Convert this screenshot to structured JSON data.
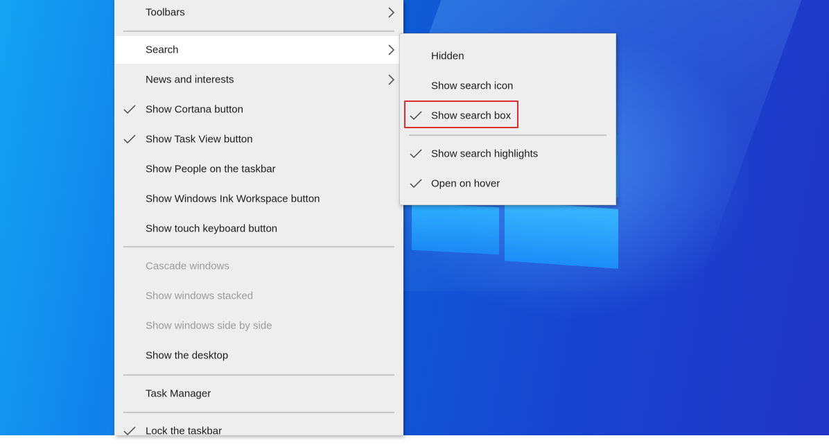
{
  "main_menu": {
    "items": [
      {
        "label": "Toolbars",
        "checked": false,
        "submenu": true,
        "disabled": false
      },
      {
        "label": "Search",
        "checked": false,
        "submenu": true,
        "disabled": false,
        "hover": true
      },
      {
        "label": "News and interests",
        "checked": false,
        "submenu": true,
        "disabled": false
      },
      {
        "label": "Show Cortana button",
        "checked": true,
        "submenu": false,
        "disabled": false
      },
      {
        "label": "Show Task View button",
        "checked": true,
        "submenu": false,
        "disabled": false
      },
      {
        "label": "Show People on the taskbar",
        "checked": false,
        "submenu": false,
        "disabled": false
      },
      {
        "label": "Show Windows Ink Workspace button",
        "checked": false,
        "submenu": false,
        "disabled": false
      },
      {
        "label": "Show touch keyboard button",
        "checked": false,
        "submenu": false,
        "disabled": false
      },
      {
        "label": "Cascade windows",
        "checked": false,
        "submenu": false,
        "disabled": true
      },
      {
        "label": "Show windows stacked",
        "checked": false,
        "submenu": false,
        "disabled": true
      },
      {
        "label": "Show windows side by side",
        "checked": false,
        "submenu": false,
        "disabled": true
      },
      {
        "label": "Show the desktop",
        "checked": false,
        "submenu": false,
        "disabled": false
      },
      {
        "label": "Task Manager",
        "checked": false,
        "submenu": false,
        "disabled": false
      },
      {
        "label": "Lock the taskbar",
        "checked": true,
        "submenu": false,
        "disabled": false
      }
    ]
  },
  "search_submenu": {
    "items": [
      {
        "label": "Hidden",
        "checked": false
      },
      {
        "label": "Show search icon",
        "checked": false
      },
      {
        "label": "Show search box",
        "checked": true,
        "highlighted": true
      },
      {
        "label": "Show search highlights",
        "checked": true
      },
      {
        "label": "Open on hover",
        "checked": true
      }
    ]
  },
  "colors": {
    "menu_background": "#eeeeee",
    "hover_background": "#ffffff",
    "disabled_text": "#9b9b9b",
    "highlight_border": "#d9302f"
  },
  "icons": {
    "check": "checkmark-icon",
    "submenu": "chevron-right-icon"
  }
}
